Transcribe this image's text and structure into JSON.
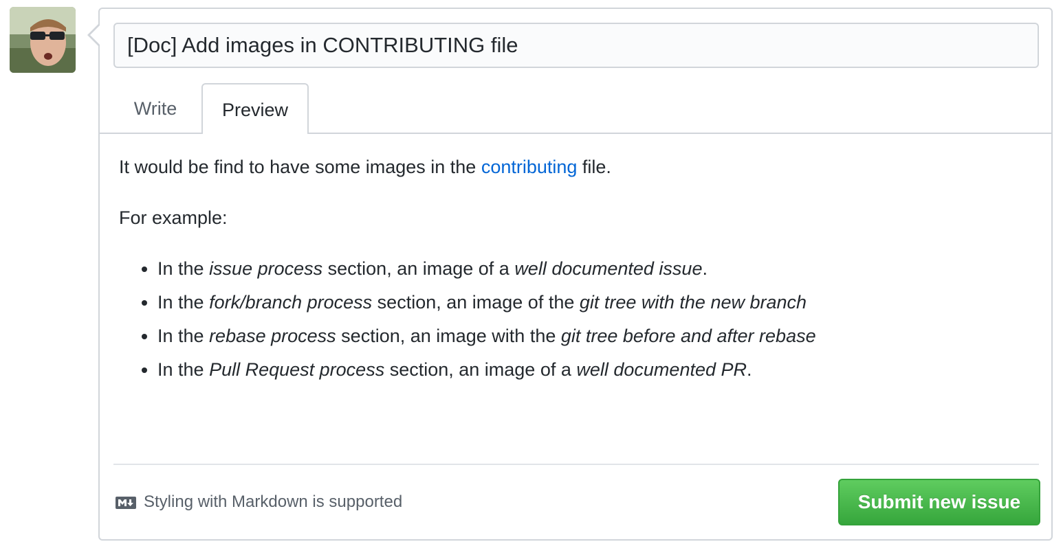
{
  "issue": {
    "title_value": "[Doc] Add images in CONTRIBUTING file"
  },
  "tabs": [
    {
      "label": "Write",
      "selected": false
    },
    {
      "label": "Preview",
      "selected": true
    }
  ],
  "preview": {
    "paragraph1": {
      "before": "It would be find to have some images in the ",
      "link": "contributing",
      "after": " file."
    },
    "paragraph2": "For example:",
    "items": [
      {
        "t1": "In the ",
        "e1": "issue process",
        "t2": " section, an image of a ",
        "e2": "well documented issue",
        "t3": "."
      },
      {
        "t1": "In the ",
        "e1": "fork/branch process",
        "t2": " section, an image of the ",
        "e2": "git tree with the new branch",
        "t3": ""
      },
      {
        "t1": "In the ",
        "e1": "rebase process",
        "t2": " section, an image with the ",
        "e2": "git tree before and after rebase",
        "t3": ""
      },
      {
        "t1": "In the ",
        "e1": "Pull Request process",
        "t2": " section, an image of a ",
        "e2": "well documented PR",
        "t3": "."
      }
    ]
  },
  "footer": {
    "markdown_icon": "markdown-icon",
    "markdown_hint": "Styling with Markdown is supported",
    "submit_label": "Submit new issue"
  },
  "colors": {
    "link": "#0366d6",
    "submit_green": "#36a63c",
    "border": "#d1d5da"
  }
}
